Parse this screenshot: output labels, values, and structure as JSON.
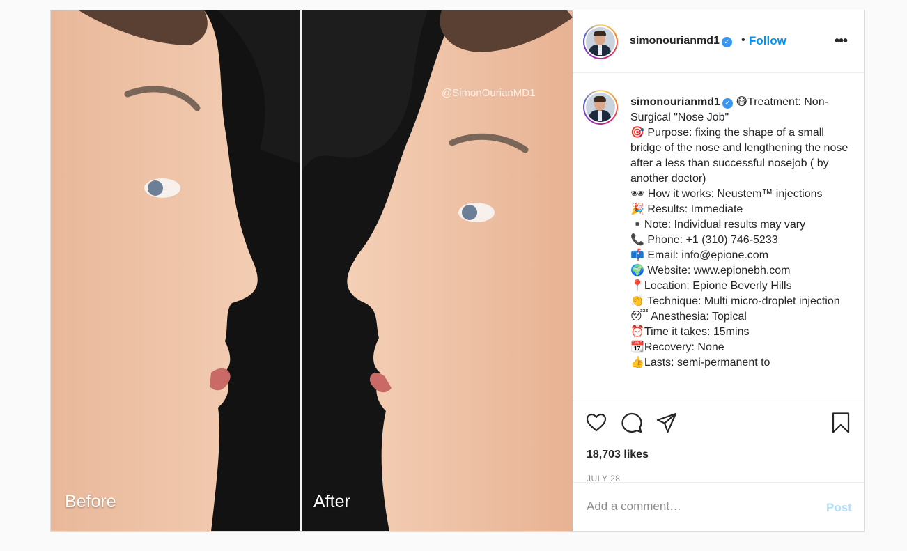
{
  "media": {
    "before_label": "Before",
    "after_label": "After",
    "watermark": "@SimonOurianMD1"
  },
  "header": {
    "username": "simonourianmd1",
    "verified_icon": "verified-badge-icon",
    "separator": "•",
    "follow_label": "Follow",
    "more_label": "•••"
  },
  "caption": {
    "username": "simonourianmd1",
    "lines": [
      "😷Treatment: Non-Surgical \"Nose Job\"",
      "🎯 Purpose: fixing the shape of a small bridge of the nose and lengthening the nose after a less than successful nosejob ( by another doctor)",
      "🕶 How it works: Neustem™ injections",
      "🎉 Results: Immediate",
      "▪️Note: Individual results may vary",
      "📞 Phone: +1 (310) 746-5233",
      "📫 Email: info@epione.com",
      "🌍 Website: www.epionebh.com",
      "📍Location: Epione Beverly Hills",
      "👏 Technique: Multi micro-droplet injection",
      "😴 Anesthesia: Topical",
      "⏰Time it takes: 15mins",
      "📆Recovery: None",
      "👍Lasts: semi-permanent to"
    ]
  },
  "actions": {
    "like_icon": "heart-icon",
    "comment_icon": "comment-icon",
    "share_icon": "share-icon",
    "save_icon": "bookmark-icon",
    "likes": "18,703 likes",
    "date": "JULY 28"
  },
  "comment": {
    "placeholder": "Add a comment…",
    "post_label": "Post",
    "post_color": "#b2dffc"
  },
  "colors": {
    "accent": "#0095f6",
    "verified": "#3897f0",
    "text": "#262626",
    "muted": "#8e8e8e"
  }
}
